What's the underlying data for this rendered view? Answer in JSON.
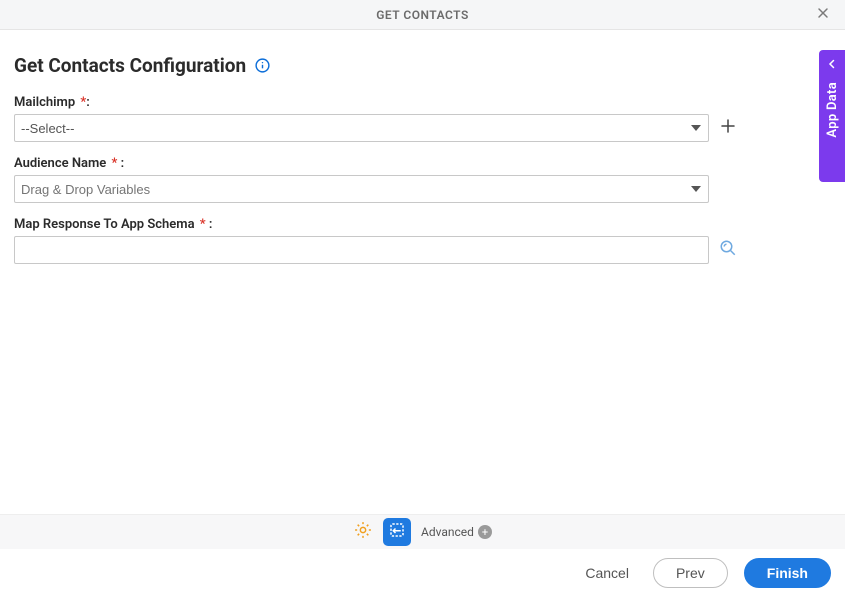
{
  "header": {
    "title": "GET CONTACTS"
  },
  "page": {
    "heading": "Get Contacts Configuration"
  },
  "fields": {
    "mailchimp": {
      "label": "Mailchimp",
      "selected": "--Select--"
    },
    "audience": {
      "label": "Audience Name",
      "placeholder": "Drag & Drop Variables"
    },
    "mapResponse": {
      "label": "Map Response To App Schema"
    }
  },
  "toolbar": {
    "advanced": "Advanced"
  },
  "actions": {
    "cancel": "Cancel",
    "prev": "Prev",
    "finish": "Finish"
  },
  "sideTab": {
    "label": "App Data"
  }
}
